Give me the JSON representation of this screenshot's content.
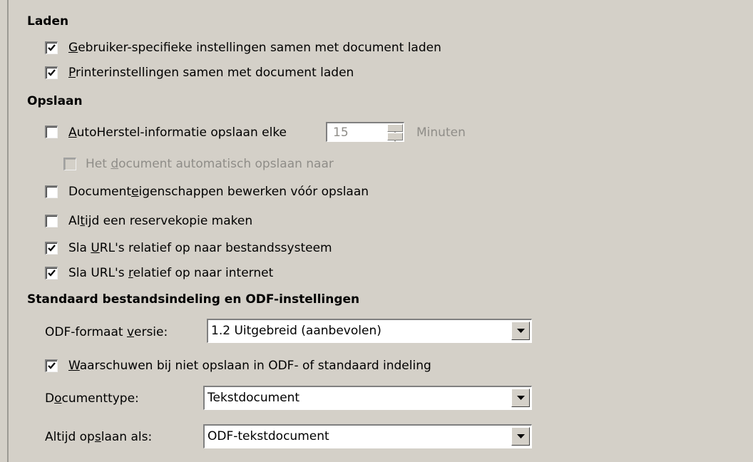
{
  "sections": {
    "laden": "Laden",
    "opslaan": "Opslaan",
    "standaard": "Standaard bestandsindeling en ODF-instellingen"
  },
  "options": {
    "user_settings": {
      "pre": "",
      "u": "G",
      "post": "ebruiker-specifieke instellingen samen met document laden",
      "checked": true
    },
    "printer_settings": {
      "pre": "",
      "u": "P",
      "post": "rinterinstellingen samen met document laden",
      "checked": true
    },
    "autorecover": {
      "pre": "",
      "u": "A",
      "post": "utoHerstel-informatie opslaan elke",
      "checked": false
    },
    "autosave": {
      "pre": "Het ",
      "u": "d",
      "post": "ocument automatisch opslaan naar",
      "checked": false,
      "disabled": true
    },
    "doc_properties": {
      "pre": "Document",
      "u": "e",
      "post": "igenschappen bewerken vóór opslaan",
      "checked": false
    },
    "backup": {
      "pre": "Al",
      "u": "t",
      "post": "ijd een reservekopie maken",
      "checked": false
    },
    "url_filesystem": {
      "pre": "Sla ",
      "u": "U",
      "post": "RL's relatief op naar bestandssysteem",
      "checked": true
    },
    "url_internet": {
      "pre": "Sla URL's ",
      "u": "r",
      "post": "elatief op naar internet",
      "checked": true
    },
    "warn_odf": {
      "pre": "",
      "u": "W",
      "post": "aarschuwen bij niet opslaan in ODF- of standaard indeling",
      "checked": true
    }
  },
  "autorecover_minutes": "15",
  "minutes_label": "Minuten",
  "odf_version": {
    "pre": "ODF-formaat ",
    "u": "v",
    "post": "ersie:",
    "value": "1.2 Uitgebreid (aanbevolen)"
  },
  "document_type": {
    "pre": "D",
    "u": "o",
    "post": "cumenttype:",
    "value": "Tekstdocument"
  },
  "always_save_as": {
    "pre": "Altijd op",
    "u": "s",
    "post": "laan als:",
    "value": "ODF-tekstdocument"
  }
}
